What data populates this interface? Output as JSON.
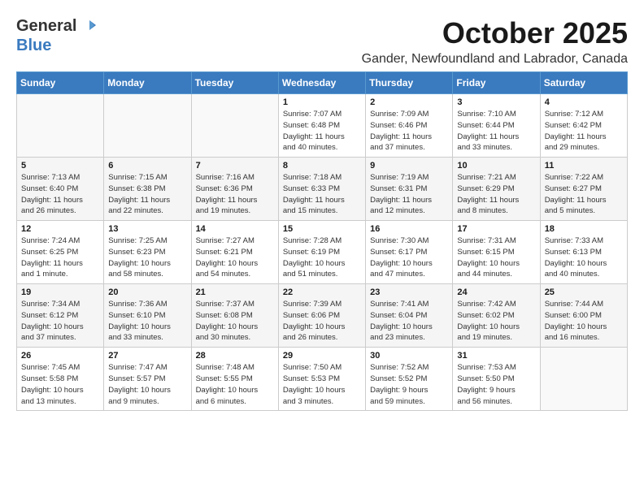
{
  "header": {
    "logo_general": "General",
    "logo_blue": "Blue",
    "month": "October 2025",
    "location": "Gander, Newfoundland and Labrador, Canada"
  },
  "weekdays": [
    "Sunday",
    "Monday",
    "Tuesday",
    "Wednesday",
    "Thursday",
    "Friday",
    "Saturday"
  ],
  "weeks": [
    [
      {
        "day": "",
        "info": ""
      },
      {
        "day": "",
        "info": ""
      },
      {
        "day": "",
        "info": ""
      },
      {
        "day": "1",
        "info": "Sunrise: 7:07 AM\nSunset: 6:48 PM\nDaylight: 11 hours\nand 40 minutes."
      },
      {
        "day": "2",
        "info": "Sunrise: 7:09 AM\nSunset: 6:46 PM\nDaylight: 11 hours\nand 37 minutes."
      },
      {
        "day": "3",
        "info": "Sunrise: 7:10 AM\nSunset: 6:44 PM\nDaylight: 11 hours\nand 33 minutes."
      },
      {
        "day": "4",
        "info": "Sunrise: 7:12 AM\nSunset: 6:42 PM\nDaylight: 11 hours\nand 29 minutes."
      }
    ],
    [
      {
        "day": "5",
        "info": "Sunrise: 7:13 AM\nSunset: 6:40 PM\nDaylight: 11 hours\nand 26 minutes."
      },
      {
        "day": "6",
        "info": "Sunrise: 7:15 AM\nSunset: 6:38 PM\nDaylight: 11 hours\nand 22 minutes."
      },
      {
        "day": "7",
        "info": "Sunrise: 7:16 AM\nSunset: 6:36 PM\nDaylight: 11 hours\nand 19 minutes."
      },
      {
        "day": "8",
        "info": "Sunrise: 7:18 AM\nSunset: 6:33 PM\nDaylight: 11 hours\nand 15 minutes."
      },
      {
        "day": "9",
        "info": "Sunrise: 7:19 AM\nSunset: 6:31 PM\nDaylight: 11 hours\nand 12 minutes."
      },
      {
        "day": "10",
        "info": "Sunrise: 7:21 AM\nSunset: 6:29 PM\nDaylight: 11 hours\nand 8 minutes."
      },
      {
        "day": "11",
        "info": "Sunrise: 7:22 AM\nSunset: 6:27 PM\nDaylight: 11 hours\nand 5 minutes."
      }
    ],
    [
      {
        "day": "12",
        "info": "Sunrise: 7:24 AM\nSunset: 6:25 PM\nDaylight: 11 hours\nand 1 minute."
      },
      {
        "day": "13",
        "info": "Sunrise: 7:25 AM\nSunset: 6:23 PM\nDaylight: 10 hours\nand 58 minutes."
      },
      {
        "day": "14",
        "info": "Sunrise: 7:27 AM\nSunset: 6:21 PM\nDaylight: 10 hours\nand 54 minutes."
      },
      {
        "day": "15",
        "info": "Sunrise: 7:28 AM\nSunset: 6:19 PM\nDaylight: 10 hours\nand 51 minutes."
      },
      {
        "day": "16",
        "info": "Sunrise: 7:30 AM\nSunset: 6:17 PM\nDaylight: 10 hours\nand 47 minutes."
      },
      {
        "day": "17",
        "info": "Sunrise: 7:31 AM\nSunset: 6:15 PM\nDaylight: 10 hours\nand 44 minutes."
      },
      {
        "day": "18",
        "info": "Sunrise: 7:33 AM\nSunset: 6:13 PM\nDaylight: 10 hours\nand 40 minutes."
      }
    ],
    [
      {
        "day": "19",
        "info": "Sunrise: 7:34 AM\nSunset: 6:12 PM\nDaylight: 10 hours\nand 37 minutes."
      },
      {
        "day": "20",
        "info": "Sunrise: 7:36 AM\nSunset: 6:10 PM\nDaylight: 10 hours\nand 33 minutes."
      },
      {
        "day": "21",
        "info": "Sunrise: 7:37 AM\nSunset: 6:08 PM\nDaylight: 10 hours\nand 30 minutes."
      },
      {
        "day": "22",
        "info": "Sunrise: 7:39 AM\nSunset: 6:06 PM\nDaylight: 10 hours\nand 26 minutes."
      },
      {
        "day": "23",
        "info": "Sunrise: 7:41 AM\nSunset: 6:04 PM\nDaylight: 10 hours\nand 23 minutes."
      },
      {
        "day": "24",
        "info": "Sunrise: 7:42 AM\nSunset: 6:02 PM\nDaylight: 10 hours\nand 19 minutes."
      },
      {
        "day": "25",
        "info": "Sunrise: 7:44 AM\nSunset: 6:00 PM\nDaylight: 10 hours\nand 16 minutes."
      }
    ],
    [
      {
        "day": "26",
        "info": "Sunrise: 7:45 AM\nSunset: 5:58 PM\nDaylight: 10 hours\nand 13 minutes."
      },
      {
        "day": "27",
        "info": "Sunrise: 7:47 AM\nSunset: 5:57 PM\nDaylight: 10 hours\nand 9 minutes."
      },
      {
        "day": "28",
        "info": "Sunrise: 7:48 AM\nSunset: 5:55 PM\nDaylight: 10 hours\nand 6 minutes."
      },
      {
        "day": "29",
        "info": "Sunrise: 7:50 AM\nSunset: 5:53 PM\nDaylight: 10 hours\nand 3 minutes."
      },
      {
        "day": "30",
        "info": "Sunrise: 7:52 AM\nSunset: 5:52 PM\nDaylight: 9 hours\nand 59 minutes."
      },
      {
        "day": "31",
        "info": "Sunrise: 7:53 AM\nSunset: 5:50 PM\nDaylight: 9 hours\nand 56 minutes."
      },
      {
        "day": "",
        "info": ""
      }
    ]
  ]
}
